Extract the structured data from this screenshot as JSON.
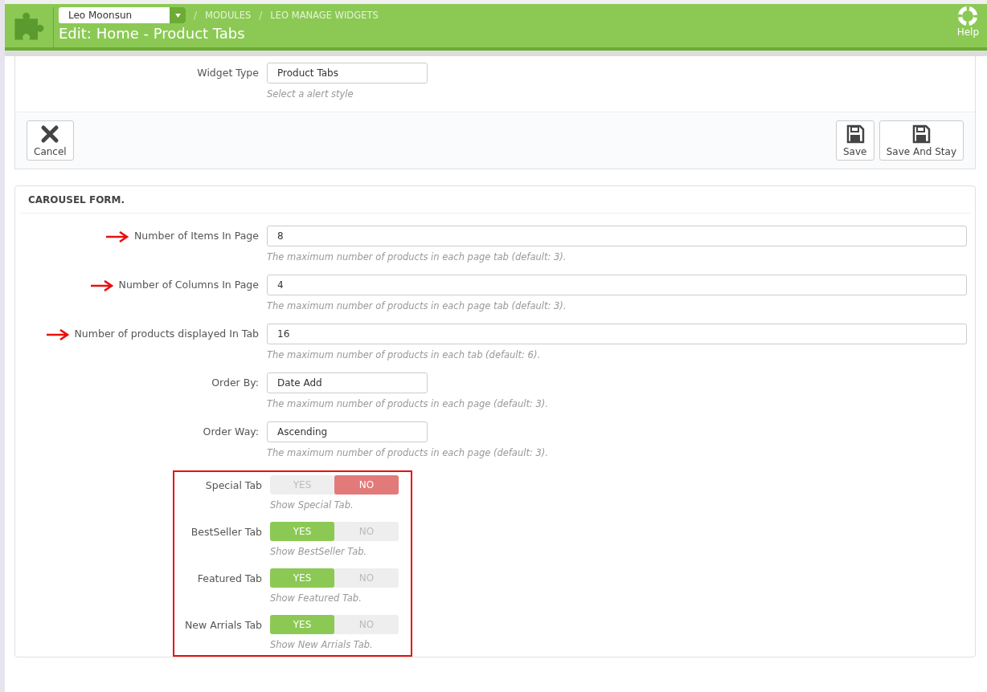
{
  "header": {
    "shop_select": "Leo Moonsun",
    "breadcrumbs": [
      {
        "separator": "/",
        "label": "MODULES"
      },
      {
        "separator": "/",
        "label": "LEO MANAGE WIDGETS"
      }
    ],
    "title": "Edit: Home - Product Tabs",
    "help": "Help"
  },
  "top_panel": {
    "widget_type": {
      "label": "Widget Type",
      "value": "Product Tabs",
      "help": "Select a alert style"
    },
    "buttons": [
      {
        "label": "Cancel",
        "kind": "cancel"
      },
      {
        "label": "Save",
        "kind": "save"
      },
      {
        "label": "Save And Stay",
        "kind": "save"
      }
    ]
  },
  "carousel_form": {
    "title": "CAROUSEL FORM.",
    "fields": [
      {
        "kind": "wide",
        "label": "Number of Items In Page",
        "value": "8",
        "help": "The maximum number of products in each page tab (default: 3).",
        "marked": true
      },
      {
        "kind": "wide",
        "label": "Number of Columns In Page",
        "value": "4",
        "help": "The maximum number of products in each page tab (default: 3).",
        "marked": true
      },
      {
        "kind": "wide",
        "label": "Number of products displayed In Tab",
        "value": "16",
        "help": "The maximum number of products in each tab (default: 6).",
        "marked": true
      },
      {
        "kind": "short",
        "label": "Order By:",
        "value": "Date Add",
        "help": "The maximum number of products in each page (default: 3).",
        "marked": false
      },
      {
        "kind": "short",
        "label": "Order Way:",
        "value": "Ascending",
        "help": "The maximum number of products in each page (default: 3).",
        "marked": false
      }
    ],
    "highlighted_switches": [
      {
        "label": "Special Tab",
        "yes": "YES",
        "no": "NO",
        "on": false,
        "help": "Show Special Tab."
      },
      {
        "label": "BestSeller Tab",
        "yes": "YES",
        "no": "NO",
        "on": true,
        "help": "Show BestSeller Tab."
      },
      {
        "label": "Featured Tab",
        "yes": "YES",
        "no": "NO",
        "on": true,
        "help": "Show Featured Tab."
      },
      {
        "label": "New Arrials Tab",
        "yes": "YES",
        "no": "NO",
        "on": true,
        "help": "Show New Arrials Tab."
      }
    ]
  }
}
